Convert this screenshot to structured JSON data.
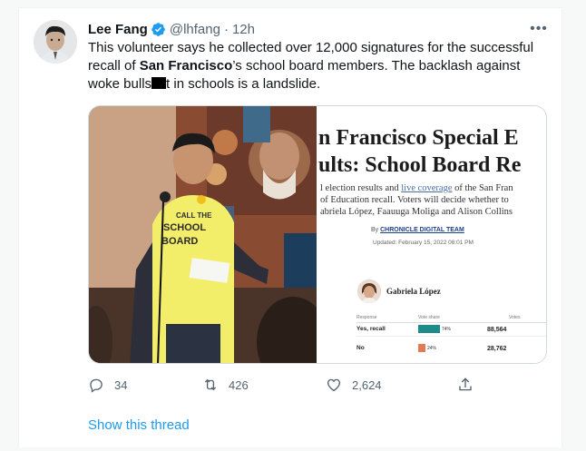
{
  "tweet": {
    "author_name": "Lee Fang",
    "handle": "@lhfang",
    "separator": "·",
    "time": "12h",
    "more_label": "•••",
    "text_part1": "This volunteer says he collected over 12,000 signatures for the successful recall of ",
    "text_bold": "San Francisco",
    "text_part2": "’s school board members. The backlash against woke bulls",
    "text_part3": "t in schools is a landslide."
  },
  "media": {
    "shirt_text": [
      "CALL THE",
      "SCHOOL",
      "BOARD"
    ],
    "article": {
      "headline_1": "n Francisco Special E",
      "headline_2": "ults: School Board Re",
      "sub_1_a": "l election results and ",
      "sub_1_link": "live coverage",
      "sub_1_b": " of the San Fran",
      "sub_2": "of Education recall. Voters will decide whether to",
      "sub_3": "abriela López, Faauuga Moliga and Alison Collins",
      "byline_prefix": "By ",
      "byline_name": "CHRONICLE DIGITAL TEAM",
      "updated": "Updated: February 15, 2022 08:01 PM",
      "candidate": "Gabriela López",
      "col_response": "Response",
      "col_share": "Vote share",
      "col_votes": "Votes",
      "rows": [
        {
          "label": "Yes, recall",
          "pct": "74%",
          "votes": "88,564",
          "share": 0.74,
          "color": "#1f8a8a"
        },
        {
          "label": "No",
          "pct": "24%",
          "votes": "28,762",
          "share": 0.24,
          "color": "#e07b53"
        }
      ]
    }
  },
  "actions": {
    "replies": "34",
    "retweets": "426",
    "likes": "2,624"
  },
  "show_thread": "Show this thread",
  "colors": {
    "accent": "#1d9bf0",
    "secondary_text": "#536471"
  }
}
